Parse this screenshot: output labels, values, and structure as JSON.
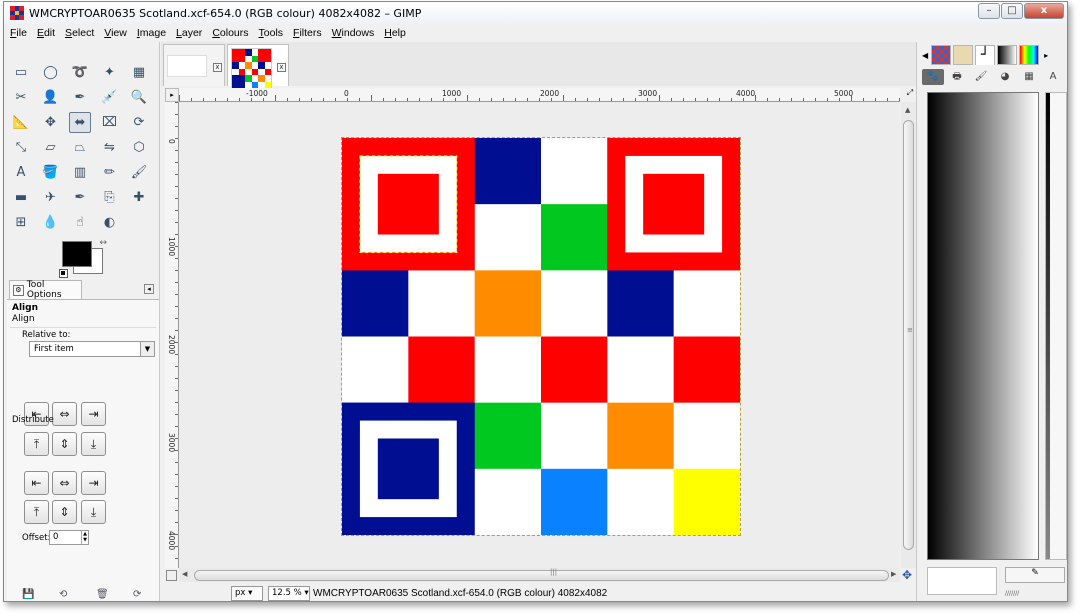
{
  "window": {
    "title": "WMCRYPTOAR0635 Scotland.xcf-654.0 (RGB colour) 4082x4082 – GIMP",
    "controls": {
      "minimize": "–",
      "maximize": "□",
      "close": "x"
    }
  },
  "menu": [
    {
      "ul": "F",
      "rest": "ile"
    },
    {
      "ul": "E",
      "rest": "dit"
    },
    {
      "ul": "S",
      "rest": "elect"
    },
    {
      "ul": "V",
      "rest": "iew"
    },
    {
      "ul": "I",
      "rest": "mage"
    },
    {
      "ul": "L",
      "rest": "ayer"
    },
    {
      "ul": "C",
      "rest": "olours"
    },
    {
      "ul": "T",
      "rest": "ools"
    },
    {
      "ul": "F",
      "rest": "ilters"
    },
    {
      "ul": "W",
      "rest": "indows"
    },
    {
      "ul": "H",
      "rest": "elp"
    }
  ],
  "toolbox": {
    "tools": [
      [
        "rect-select-icon",
        "▭"
      ],
      [
        "ellipse-select-icon",
        "◯"
      ],
      [
        "free-select-icon",
        "➰"
      ],
      [
        "fuzzy-select-icon",
        "✦"
      ],
      [
        "color-select-icon",
        "▦"
      ],
      [
        "scissors-icon",
        "✂"
      ],
      [
        "foreground-select-icon",
        "👤"
      ],
      [
        "paths-icon",
        "✒"
      ],
      [
        "color-picker-icon",
        "💉"
      ],
      [
        "zoom-icon",
        "🔍"
      ],
      [
        "measure-icon",
        "📐"
      ],
      [
        "move-icon",
        "✥"
      ],
      [
        "align-icon",
        "⬌"
      ],
      [
        "crop-icon",
        "⌧"
      ],
      [
        "rotate-icon",
        "⟳"
      ],
      [
        "scale-icon",
        "⤡"
      ],
      [
        "shear-icon",
        "▱"
      ],
      [
        "perspective-icon",
        "⏢"
      ],
      [
        "flip-icon",
        "⇋"
      ],
      [
        "cage-icon",
        "⬡"
      ],
      [
        "text-icon",
        "A"
      ],
      [
        "bucket-fill-icon",
        "🪣"
      ],
      [
        "blend-icon",
        "▥"
      ],
      [
        "pencil-icon",
        "✏"
      ],
      [
        "paintbrush-icon",
        "🖌"
      ],
      [
        "eraser-icon",
        "▬"
      ],
      [
        "airbrush-icon",
        "✈"
      ],
      [
        "ink-icon",
        "✒"
      ],
      [
        "clone-icon",
        "⎘"
      ],
      [
        "heal-icon",
        "✚"
      ],
      [
        "perspective-clone-icon",
        "⊞"
      ],
      [
        "blur-icon",
        "💧"
      ],
      [
        "smudge-icon",
        "☝"
      ],
      [
        "dodge-burn-icon",
        "◐"
      ]
    ],
    "active_tool": 12,
    "swap_icon": "↔"
  },
  "tool_options": {
    "tab_label": "Tool Options",
    "title": "Align",
    "subtitle": "Align",
    "relative_label": "Relative to:",
    "relative_value": "First item",
    "dropdown_arrow": "▼",
    "align_buttons": [
      "⇤",
      "⇔",
      "⇥",
      "⤒",
      "⇕",
      "⤓"
    ],
    "distribute_label": "Distribute",
    "distribute_buttons": [
      "⇤",
      "⇔",
      "⇥",
      "⤒",
      "⇕",
      "⤓"
    ],
    "offset_label": "Offset:",
    "offset_value": "0"
  },
  "image_tabs": {
    "close_glyph": "x"
  },
  "rulers": {
    "top_labels": [
      "-1000",
      "0",
      "1000",
      "2000",
      "3000",
      "4000",
      "5000"
    ],
    "left_labels": [
      "0",
      "1000",
      "2000",
      "3000",
      "4000"
    ]
  },
  "image": {
    "grid": [
      [
        "#ff0000",
        "#ff0000",
        "#000f91",
        "#ffffff",
        "#ff0000",
        "#ff0000"
      ],
      [
        "#ff0000",
        "#ff0000",
        "#ffffff",
        "#00c81e",
        "#ff0000",
        "#ff0000"
      ],
      [
        "#000f91",
        "#ffffff",
        "#ff8c00",
        "#ffffff",
        "#000f91",
        "#ffffff"
      ],
      [
        "#ffffff",
        "#ff0000",
        "#ffffff",
        "#ff0000",
        "#ffffff",
        "#ff0000"
      ],
      [
        "#000f91",
        "#000f91",
        "#00c81e",
        "#ffffff",
        "#ff8c00",
        "#ffffff"
      ],
      [
        "#000f91",
        "#000f91",
        "#ffffff",
        "#0a82ff",
        "#ffffff",
        "#ffff00"
      ]
    ],
    "finders": [
      {
        "corner": "top-left",
        "color": "#ff0000"
      },
      {
        "corner": "top-right",
        "color": "#ff0000"
      },
      {
        "corner": "bottom-left",
        "color": "#000f91"
      }
    ]
  },
  "status": {
    "unit": "px",
    "zoom": "12.5 %",
    "text": "WMCRYPTOAR0635 Scotland.xcf-654.0 (RGB colour) 4082x4082"
  },
  "colors": {
    "red": "#ff0000",
    "navy": "#000f91",
    "green": "#00c81e",
    "orange": "#ff8c00",
    "blue": "#0a82ff",
    "yellow": "#ffff00",
    "white": "#ffffff"
  }
}
